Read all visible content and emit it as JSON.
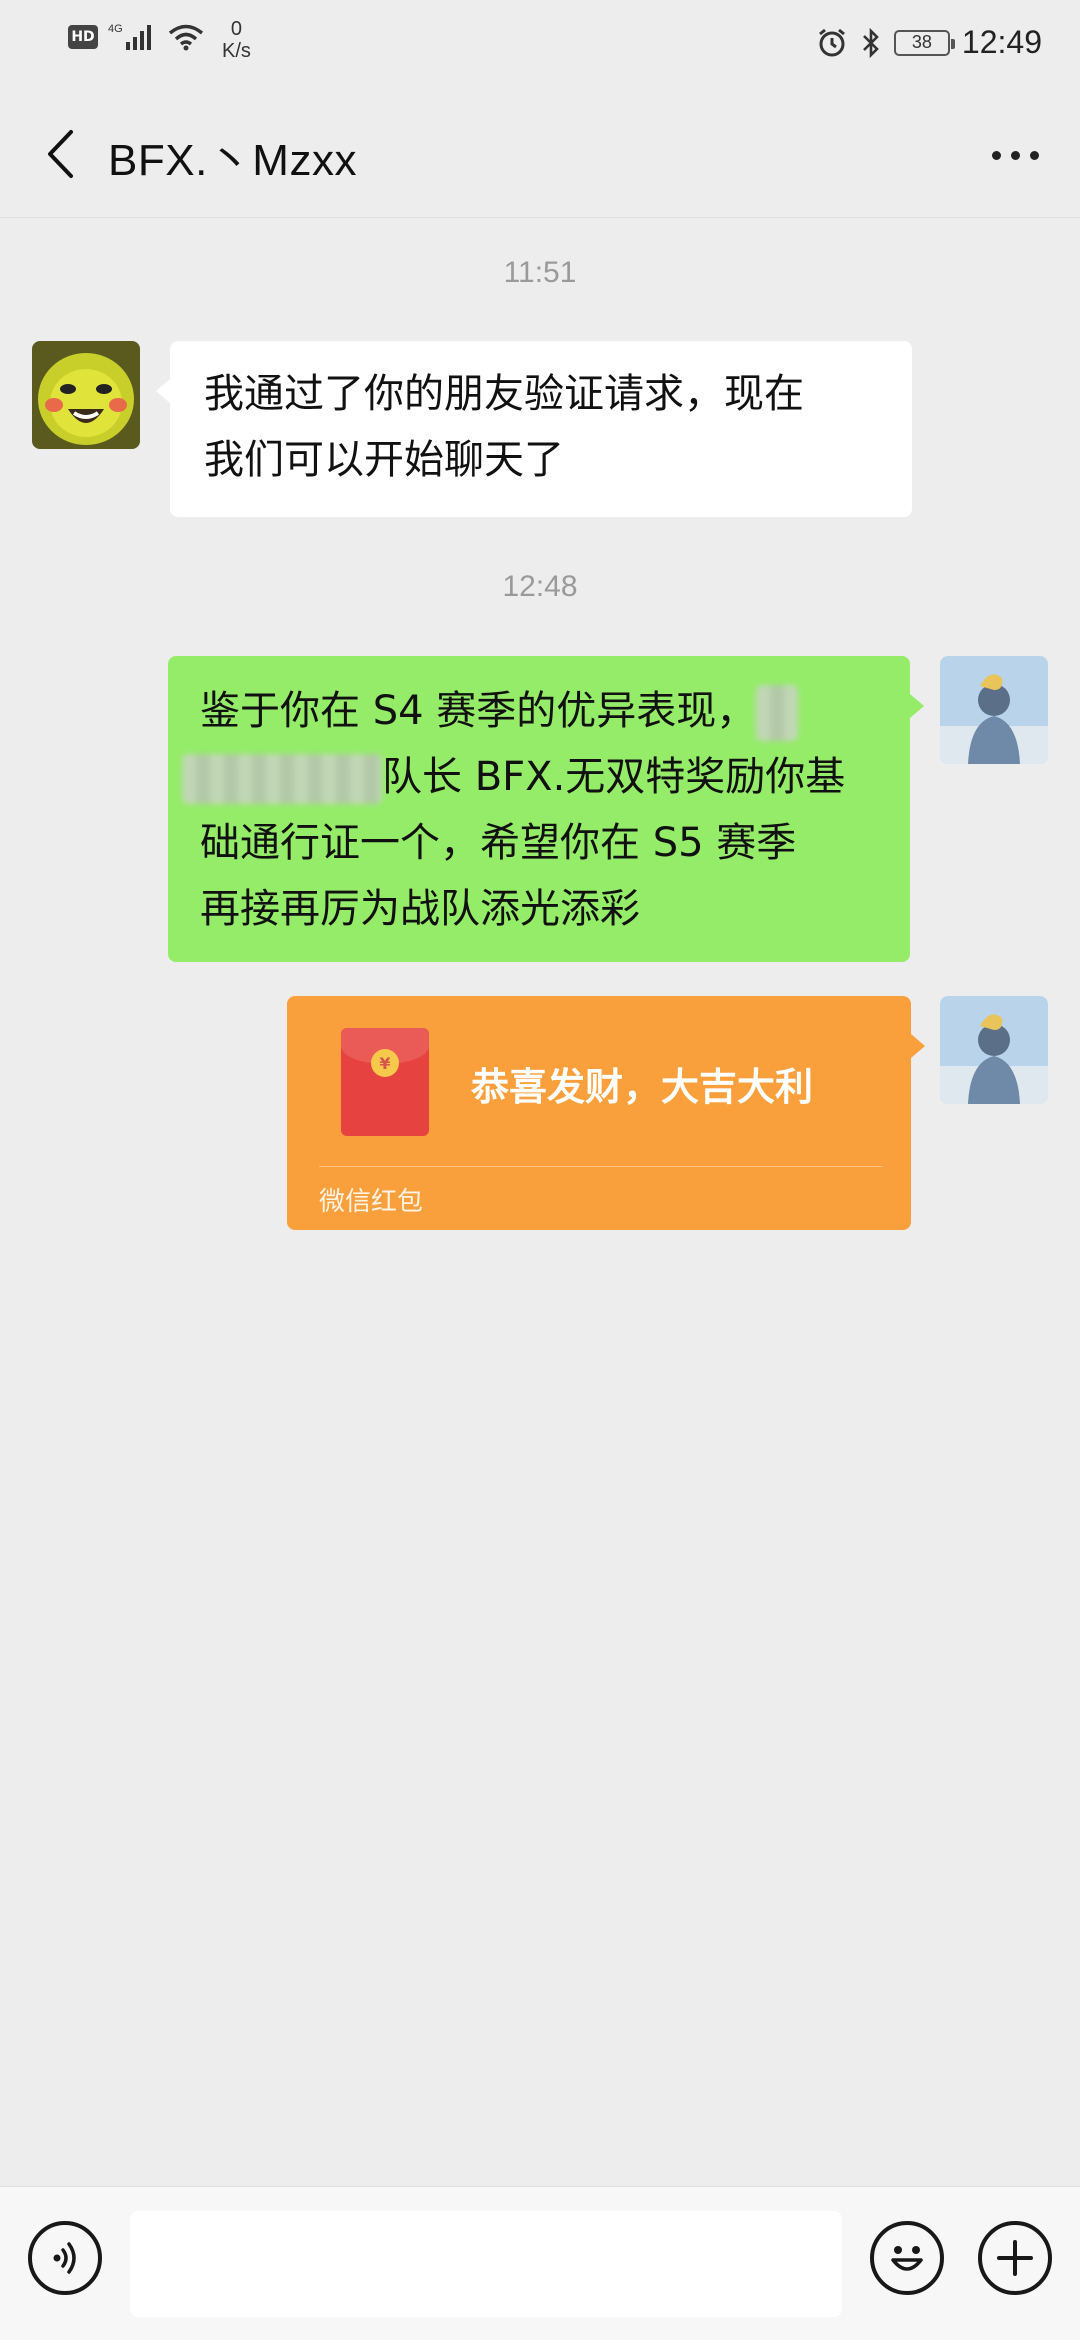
{
  "status_bar": {
    "hd": "HD",
    "network": "4G",
    "speed_value": "0",
    "speed_unit": "K/s",
    "battery": "38",
    "time": "12:49",
    "icons": [
      "signal-icon",
      "wifi-icon",
      "alarm-icon",
      "bluetooth-icon",
      "battery-icon"
    ]
  },
  "header": {
    "title": "BFX.丶Mzxx"
  },
  "messages": {
    "timestamp_1": "11:51",
    "msg_1": {
      "sender": "other",
      "line_1": "我通过了你的朋友验证请求，现在",
      "line_2": "我们可以开始聊天了"
    },
    "timestamp_2": "12:48",
    "msg_2": {
      "sender": "self",
      "line_1": "鉴于你在 S4 赛季的优异表现，",
      "line_2": "队长 BFX.无双特奖励你基",
      "line_3": "础通行证一个，希望你在 S5 赛季",
      "line_4": "再接再厉为战队添光添彩"
    },
    "msg_3": {
      "sender": "self",
      "type": "red-envelope",
      "greeting": "恭喜发财，大吉大利",
      "label": "微信红包",
      "coin": "¥"
    }
  },
  "input_bar": {
    "placeholder": ""
  },
  "colors": {
    "background": "#ededed",
    "self_bubble": "#95ec69",
    "other_bubble": "#ffffff",
    "red_envelope": "#f9a03c"
  }
}
